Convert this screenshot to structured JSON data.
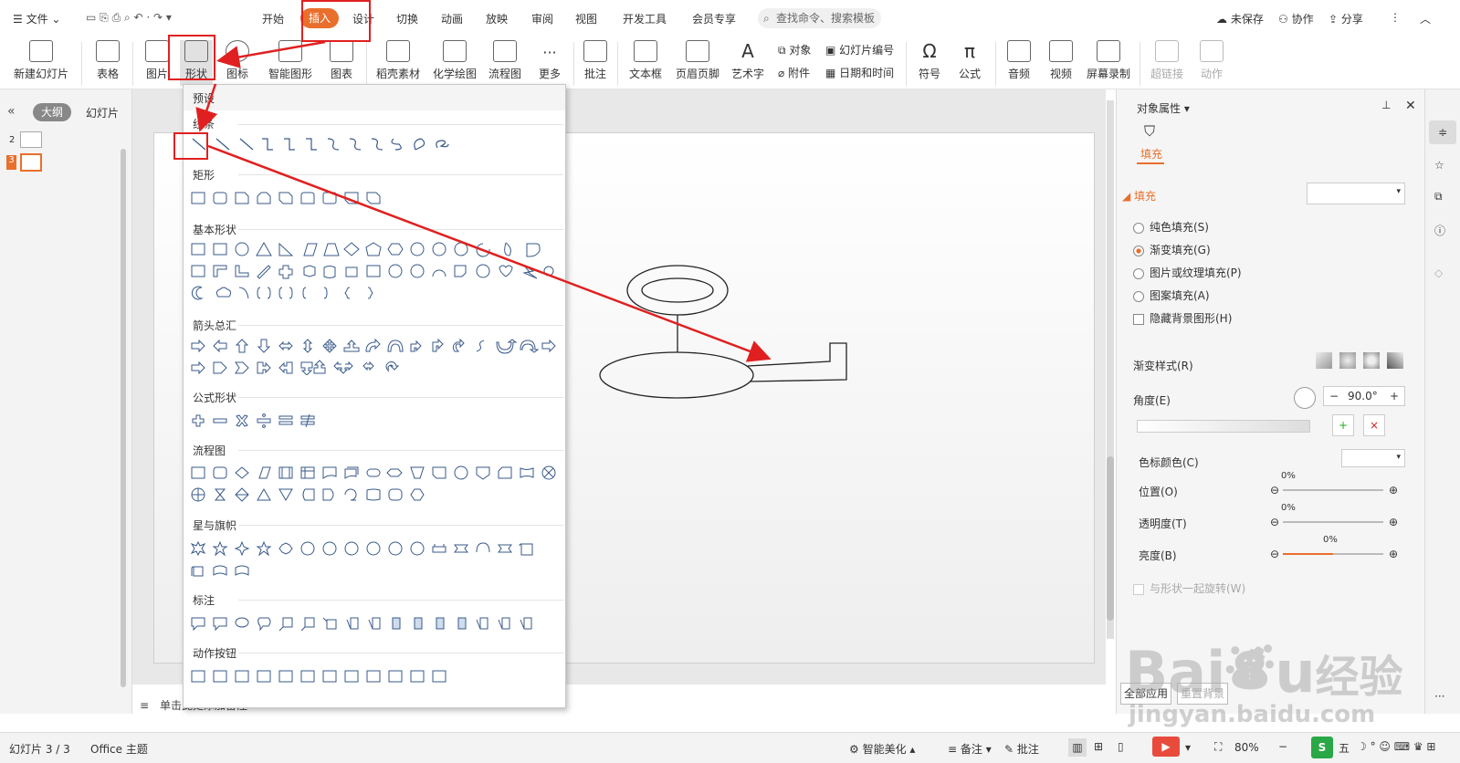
{
  "topbar": {
    "file_menu": "文件",
    "tabs": [
      "开始",
      "插入",
      "设计",
      "切换",
      "动画",
      "放映",
      "审阅",
      "视图",
      "开发工具",
      "会员专享"
    ],
    "active_tab": "插入",
    "search_placeholder": "查找命令、搜索模板",
    "unsaved": "未保存",
    "collaborate": "协作",
    "share": "分享"
  },
  "ribbon": {
    "new_slide": "新建幻灯片",
    "table": "表格",
    "picture": "图片",
    "shape": "形状",
    "icon": "图标",
    "smartart": "智能图形",
    "chart": "图表",
    "material": "稻壳素材",
    "chem": "化学绘图",
    "flow": "流程图",
    "more": "更多",
    "comment": "批注",
    "textbox": "文本框",
    "header_footer": "页眉页脚",
    "wordart": "艺术字",
    "object": "对象",
    "attachment": "附件",
    "slide_number": "幻灯片编号",
    "date_time": "日期和时间",
    "symbol": "符号",
    "formula": "公式",
    "audio": "音频",
    "video": "视频",
    "screen_record": "屏幕录制",
    "hyperlink": "超链接",
    "action": "动作"
  },
  "leftpanel": {
    "tab_outline": "大纲",
    "tab_slides": "幻灯片",
    "thumbs": [
      "2",
      "3"
    ]
  },
  "shape_menu": {
    "preset": "预设",
    "sections": [
      "线条",
      "矩形",
      "基本形状",
      "箭头总汇",
      "公式形状",
      "流程图",
      "星与旗帜",
      "标注",
      "动作按钮"
    ]
  },
  "notes": "单击此处添加备注",
  "rightpanel": {
    "title": "对象属性",
    "tab_fill": "填充",
    "section_fill": "填充",
    "options": [
      "纯色填充(S)",
      "渐变填充(G)",
      "图片或纹理填充(P)",
      "图案填充(A)"
    ],
    "hide_bg": "隐藏背景图形(H)",
    "gradient_style": "渐变样式(R)",
    "angle": "角度(E)",
    "angle_value": "90.0°",
    "stop_color": "色标颜色(C)",
    "position": "位置(O)",
    "transparency": "透明度(T)",
    "brightness": "亮度(B)",
    "position_value": "0%",
    "transparency_value": "0%",
    "brightness_value": "0%",
    "rotate_with_shape": "与形状一起旋转(W)",
    "apply_all": "全部应用",
    "reset_bg": "重置背景"
  },
  "status": {
    "slide_info": "幻灯片 3 / 3",
    "theme": "Office 主题",
    "beautify": "智能美化",
    "notes": "备注",
    "comment": "批注",
    "zoom": "80%",
    "ime": "五"
  },
  "watermark": {
    "brand": "Bai",
    "brand2": "经验",
    "url": "jingyan.baidu.com"
  },
  "colors": {
    "accent": "#e96f2c",
    "annotation": "#e02020"
  }
}
